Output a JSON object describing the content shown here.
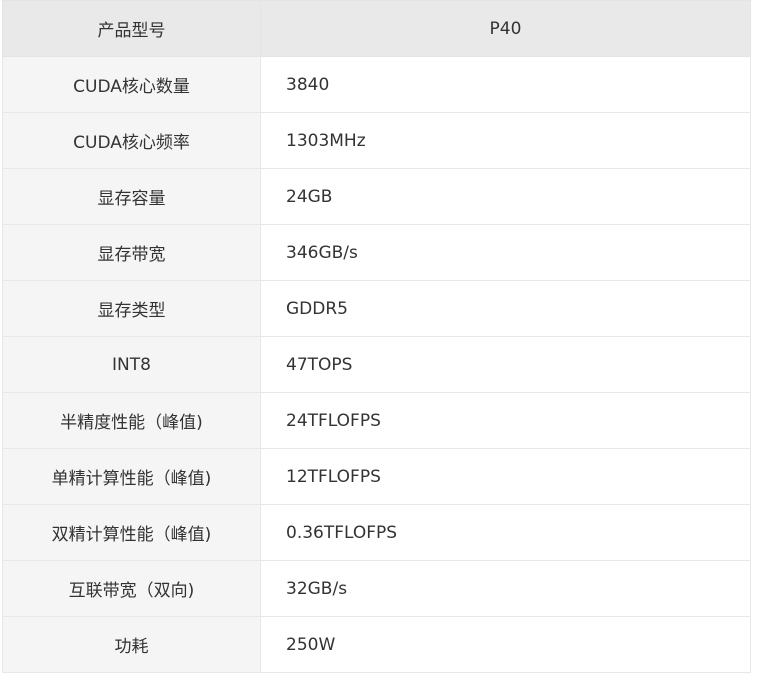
{
  "table": {
    "header": {
      "label": "产品型号",
      "value": "P40"
    },
    "rows": [
      {
        "label": "CUDA核心数量",
        "value": "3840"
      },
      {
        "label": "CUDA核心频率",
        "value": "1303MHz"
      },
      {
        "label": "显存容量",
        "value": "24GB"
      },
      {
        "label": "显存带宽",
        "value": "346GB/s"
      },
      {
        "label": "显存类型",
        "value": "GDDR5"
      },
      {
        "label": "INT8",
        "value": "47TOPS"
      },
      {
        "label": "半精度性能（峰值)",
        "value": "24TFLOFPS"
      },
      {
        "label": "单精计算性能（峰值)",
        "value": "12TFLOFPS"
      },
      {
        "label": "双精计算性能（峰值)",
        "value": "0.36TFLOFPS"
      },
      {
        "label": "互联带宽（双向)",
        "value": "32GB/s"
      },
      {
        "label": "功耗",
        "value": "250W"
      }
    ]
  }
}
